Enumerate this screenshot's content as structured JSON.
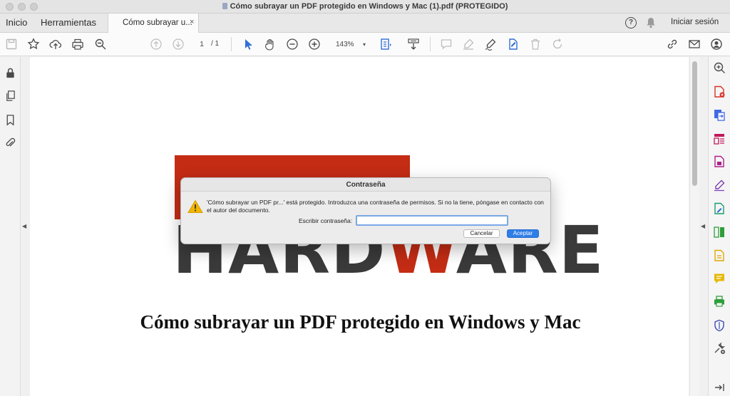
{
  "window": {
    "title": "Cómo subrayar un PDF protegido en Windows y Mac (1).pdf (PROTEGIDO)"
  },
  "tabs": {
    "home": "Inicio",
    "tools": "Herramientas",
    "document": "Cómo subrayar u...",
    "close_glyph": "×"
  },
  "header": {
    "help_glyph": "?",
    "sign_in": "Iniciar sesión"
  },
  "toolbar": {
    "page_current": "1",
    "page_total": "/ 1",
    "zoom": "143%",
    "zoom_caret": "▾",
    "icons": [
      "save-icon",
      "star-icon",
      "upload-icon",
      "print-icon",
      "zoom-out-search-icon",
      "page-up-icon",
      "page-down-icon",
      "select-arrow-icon",
      "hand-icon",
      "zoom-out-icon",
      "zoom-in-icon",
      "fit-page-icon",
      "scroll-mode-icon",
      "comment-icon",
      "highlight-icon",
      "sign-icon",
      "edit-text-icon",
      "delete-icon",
      "rotate-icon",
      "link-icon",
      "mail-icon",
      "account-icon"
    ]
  },
  "document": {
    "logo_bottom_left": "HARD",
    "logo_bottom_red": "W",
    "logo_bottom_right": "ARE",
    "heading": "Cómo subrayar un PDF protegido en Windows y Mac"
  },
  "dialog": {
    "title": "Contraseña",
    "message": "'Cómo subrayar un PDF pr...' está protegido. Introduzca una contraseña de permisos. Si no la tiene, póngase en contacto con el autor del documento.",
    "password_label": "Escribir contraseña:",
    "password_value": "",
    "cancel_label": "Cancelar",
    "ok_label": "Aceptar"
  },
  "colors": {
    "accent": "#2f7ee8",
    "logo_red": "#c42c14",
    "logo_dark": "#3a3a3a"
  }
}
